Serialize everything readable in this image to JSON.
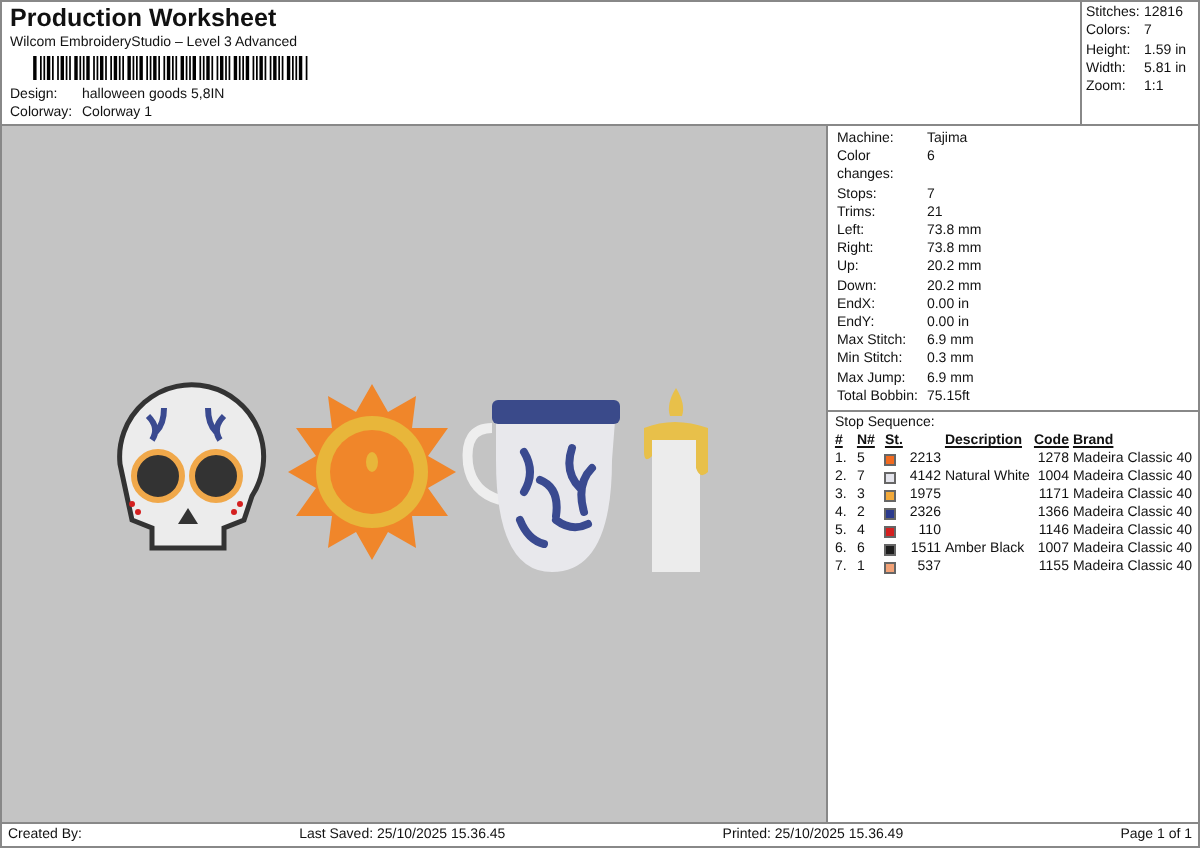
{
  "header": {
    "title": "Production Worksheet",
    "subtitle": "Wilcom EmbroideryStudio – Level 3 Advanced",
    "fields": [
      {
        "label": "Design:",
        "value": "halloween goods 5,8IN"
      },
      {
        "label": "Colorway:",
        "value": "Colorway 1"
      }
    ]
  },
  "summary": [
    {
      "label": "Stitches:",
      "value": "12816"
    },
    {
      "label": "Colors:",
      "value": "7"
    },
    {
      "label": "Height:",
      "value": "1.59 in"
    },
    {
      "label": "Width:",
      "value": "5.81 in"
    },
    {
      "label": "Zoom:",
      "value": "1:1"
    }
  ],
  "details": [
    {
      "label": "Machine:",
      "value": "Tajima"
    },
    {
      "label": "Color changes:",
      "value": "6"
    },
    {
      "label": "Stops:",
      "value": "7"
    },
    {
      "label": "Trims:",
      "value": "21"
    },
    {
      "label": "Left:",
      "value": "73.8 mm"
    },
    {
      "label": "Right:",
      "value": "73.8 mm"
    },
    {
      "label": "Up:",
      "value": "20.2 mm"
    },
    {
      "label": "Down:",
      "value": "20.2 mm"
    },
    {
      "label": "EndX:",
      "value": "0.00 in"
    },
    {
      "label": "EndY:",
      "value": "0.00 in"
    },
    {
      "label": "Max Stitch:",
      "value": "6.9 mm"
    },
    {
      "label": "Min Stitch:",
      "value": "0.3 mm"
    },
    {
      "label": "Max Jump:",
      "value": "6.9 mm"
    },
    {
      "label": "Total Bobbin:",
      "value": "75.15ft"
    }
  ],
  "stop_sequence": {
    "title": "Stop Sequence:",
    "columns": [
      "#",
      "N#",
      "St.",
      "Description",
      "Code",
      "Brand"
    ],
    "rows": [
      {
        "index": "1.",
        "needle": "5",
        "color": "#f26a1f",
        "stitches": "2213",
        "description": "",
        "code": "1278",
        "brand": "Madeira Classic 40"
      },
      {
        "index": "2.",
        "needle": "7",
        "color": "#e4e4ec",
        "stitches": "4142",
        "description": "Natural White",
        "code": "1004",
        "brand": "Madeira Classic 40"
      },
      {
        "index": "3.",
        "needle": "3",
        "color": "#f2a93a",
        "stitches": "1975",
        "description": "",
        "code": "1171",
        "brand": "Madeira Classic 40"
      },
      {
        "index": "4.",
        "needle": "2",
        "color": "#2b3a8c",
        "stitches": "2326",
        "description": "",
        "code": "1366",
        "brand": "Madeira Classic 40"
      },
      {
        "index": "5.",
        "needle": "4",
        "color": "#d42020",
        "stitches": "110",
        "description": "",
        "code": "1146",
        "brand": "Madeira Classic 40"
      },
      {
        "index": "6.",
        "needle": "6",
        "color": "#1e1e1e",
        "stitches": "1511",
        "description": "Amber Black",
        "code": "1007",
        "brand": "Madeira Classic 40"
      },
      {
        "index": "7.",
        "needle": "1",
        "color": "#f2a277",
        "stitches": "537",
        "description": "",
        "code": "1155",
        "brand": "Madeira Classic 40"
      }
    ]
  },
  "footer": {
    "created_by": "Created By:",
    "last_saved": "Last Saved: 25/10/2025 15.36.45",
    "printed": "Printed: 25/10/2025 15.36.49",
    "page": "Page 1 of 1"
  }
}
